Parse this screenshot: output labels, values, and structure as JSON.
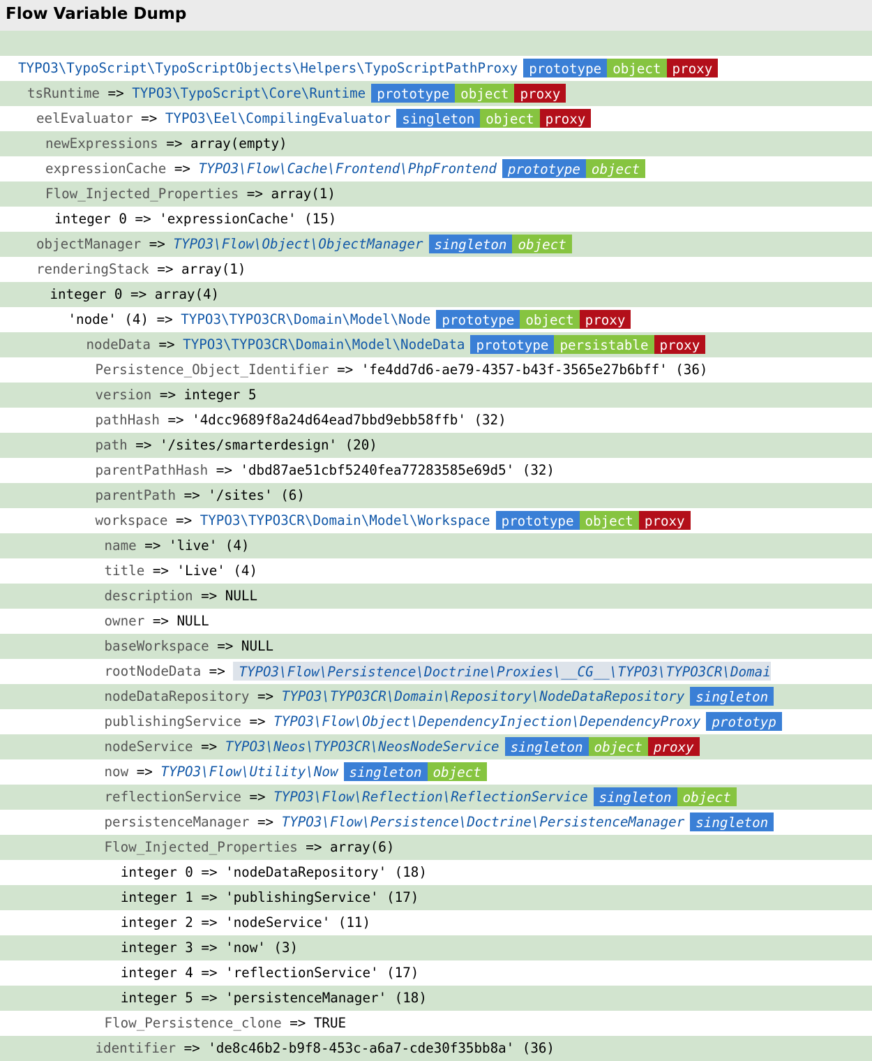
{
  "window": {
    "title": "Flow Variable Dump"
  },
  "colors": {
    "prototype": "#3a7fd6",
    "singleton": "#3a7fd6",
    "object": "#86c440",
    "persistable": "#86c440",
    "proxy": "#b30f1a",
    "class_link": "#1258a8",
    "stripe": "#d2e4cf"
  },
  "rows": [
    {
      "indent": 0,
      "key": "",
      "class": "TYPO3\\TypoScript\\TypoScriptObjects\\Helpers\\TypoScriptPathProxy",
      "italic": false,
      "badges": [
        "prototype",
        "object",
        "proxy"
      ]
    },
    {
      "indent": 1,
      "key": "tsRuntime",
      "class": "TYPO3\\TypoScript\\Core\\Runtime",
      "italic": false,
      "badges": [
        "prototype",
        "object",
        "proxy"
      ]
    },
    {
      "indent": 2,
      "key": "eelEvaluator",
      "class": "TYPO3\\Eel\\CompilingEvaluator",
      "italic": false,
      "badges": [
        "singleton",
        "object",
        "proxy"
      ]
    },
    {
      "indent": 3,
      "key": "newExpressions",
      "value": "array(empty)"
    },
    {
      "indent": 3,
      "key": "expressionCache",
      "class": "TYPO3\\Flow\\Cache\\Frontend\\PhpFrontend",
      "italic": true,
      "badges": [
        "prototype",
        "object"
      ]
    },
    {
      "indent": 3,
      "key": "Flow_Injected_Properties",
      "value": "array(1)"
    },
    {
      "indent": 4,
      "key": "integer 0",
      "strong": true,
      "value": "'expressionCache' (15)"
    },
    {
      "indent": 2,
      "key": "objectManager",
      "class": "TYPO3\\Flow\\Object\\ObjectManager",
      "italic": true,
      "badges": [
        "singleton",
        "object"
      ]
    },
    {
      "indent": 2,
      "key": "renderingStack",
      "value": "array(1)"
    },
    {
      "indent": 3.5,
      "key": "integer 0",
      "strong": true,
      "value": "array(4)"
    },
    {
      "indent": 5.5,
      "key": "'node' (4)",
      "strong": true,
      "class": "TYPO3\\TYPO3CR\\Domain\\Model\\Node",
      "italic": false,
      "badges": [
        "prototype",
        "object",
        "proxy"
      ]
    },
    {
      "indent": 7.5,
      "key": "nodeData",
      "class": "TYPO3\\TYPO3CR\\Domain\\Model\\NodeData",
      "italic": false,
      "badges": [
        "prototype",
        "persistable",
        "proxy"
      ]
    },
    {
      "indent": 8.5,
      "key": "Persistence_Object_Identifier",
      "value": "'fe4dd7d6-ae79-4357-b43f-3565e27b6bff' (36)"
    },
    {
      "indent": 8.5,
      "key": "version",
      "value": "integer 5"
    },
    {
      "indent": 8.5,
      "key": "pathHash",
      "value": "'4dcc9689f8a24d64ead7bbd9ebb58ffb' (32)"
    },
    {
      "indent": 8.5,
      "key": "path",
      "value": "'/sites/smarterdesign' (20)"
    },
    {
      "indent": 8.5,
      "key": "parentPathHash",
      "value": "'dbd87ae51cbf5240fea77283585e69d5' (32)"
    },
    {
      "indent": 8.5,
      "key": "parentPath",
      "value": "'/sites' (6)"
    },
    {
      "indent": 8.5,
      "key": "workspace",
      "class": "TYPO3\\TYPO3CR\\Domain\\Model\\Workspace",
      "italic": false,
      "badges": [
        "prototype",
        "object",
        "proxy"
      ]
    },
    {
      "indent": 9.5,
      "key": "name",
      "value": "'live' (4)"
    },
    {
      "indent": 9.5,
      "key": "title",
      "value": "'Live' (4)"
    },
    {
      "indent": 9.5,
      "key": "description",
      "value": "NULL"
    },
    {
      "indent": 9.5,
      "key": "owner",
      "value": "NULL"
    },
    {
      "indent": 9.5,
      "key": "baseWorkspace",
      "value": "NULL"
    },
    {
      "indent": 9.5,
      "key": "rootNodeData",
      "box": "TYPO3\\Flow\\Persistence\\Doctrine\\Proxies\\__CG__\\TYPO3\\TYPO3CR\\Domai"
    },
    {
      "indent": 9.5,
      "key": "nodeDataRepository",
      "class": "TYPO3\\TYPO3CR\\Domain\\Repository\\NodeDataRepository",
      "italic": true,
      "badges": [
        "singleton"
      ]
    },
    {
      "indent": 9.5,
      "key": "publishingService",
      "class": "TYPO3\\Flow\\Object\\DependencyInjection\\DependencyProxy",
      "italic": true,
      "badges": [
        "prototyp"
      ]
    },
    {
      "indent": 9.5,
      "key": "nodeService",
      "class": "TYPO3\\Neos\\TYPO3CR\\NeosNodeService",
      "italic": true,
      "badges": [
        "singleton",
        "object",
        "proxy"
      ]
    },
    {
      "indent": 9.5,
      "key": "now",
      "class": "TYPO3\\Flow\\Utility\\Now",
      "italic": true,
      "badges": [
        "singleton",
        "object"
      ]
    },
    {
      "indent": 9.5,
      "key": "reflectionService",
      "class": "TYPO3\\Flow\\Reflection\\ReflectionService",
      "italic": true,
      "badges": [
        "singleton",
        "object"
      ]
    },
    {
      "indent": 9.5,
      "key": "persistenceManager",
      "class": "TYPO3\\Flow\\Persistence\\Doctrine\\PersistenceManager",
      "italic": true,
      "badges": [
        "singleton"
      ]
    },
    {
      "indent": 9.5,
      "key": "Flow_Injected_Properties",
      "value": "array(6)"
    },
    {
      "indent": 11.3,
      "key": "integer 0",
      "strong": true,
      "value": "'nodeDataRepository' (18)"
    },
    {
      "indent": 11.3,
      "key": "integer 1",
      "strong": true,
      "value": "'publishingService' (17)"
    },
    {
      "indent": 11.3,
      "key": "integer 2",
      "strong": true,
      "value": "'nodeService' (11)"
    },
    {
      "indent": 11.3,
      "key": "integer 3",
      "strong": true,
      "value": "'now' (3)"
    },
    {
      "indent": 11.3,
      "key": "integer 4",
      "strong": true,
      "value": "'reflectionService' (17)"
    },
    {
      "indent": 11.3,
      "key": "integer 5",
      "strong": true,
      "value": "'persistenceManager' (18)"
    },
    {
      "indent": 9.5,
      "key": "Flow_Persistence_clone",
      "value": "TRUE"
    },
    {
      "indent": 8.5,
      "key": "identifier",
      "value": "'de8c46b2-b9f8-453c-a6a7-cde30f35bb8a' (36)"
    }
  ]
}
